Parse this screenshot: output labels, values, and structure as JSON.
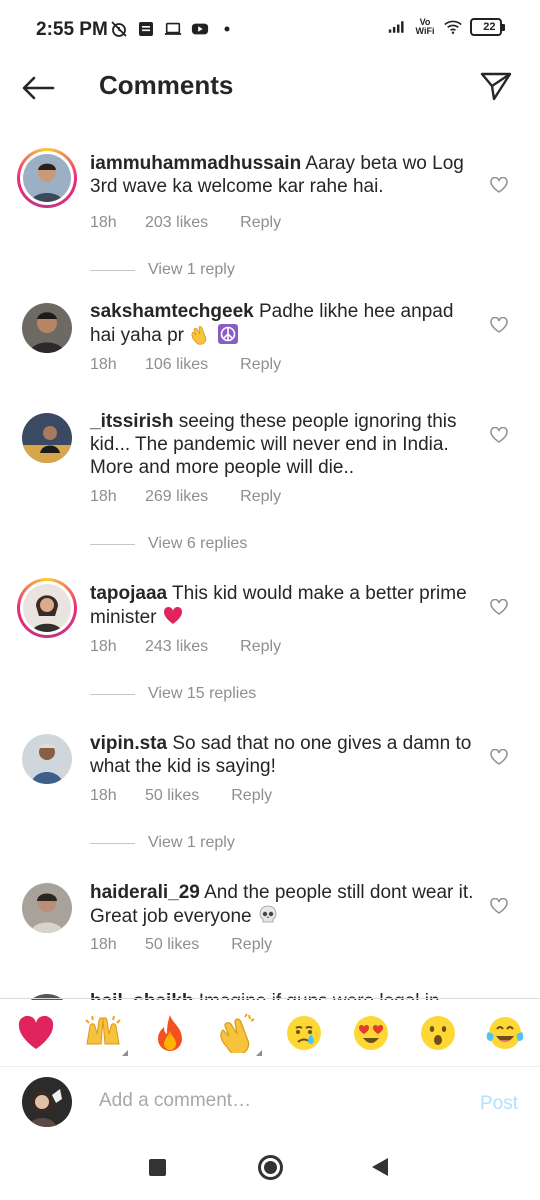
{
  "status_bar": {
    "time": "2:55 PM",
    "network_label": "Vo WiFi",
    "battery": "22"
  },
  "header": {
    "title": "Comments"
  },
  "comments": [
    {
      "username": "iammuhammadhussain",
      "text": "Aaray beta wo Log 3rd wave ka welcome kar rahe hai.",
      "time": "18h",
      "likes": "203 likes",
      "reply": "Reply",
      "view_replies": "View 1 reply",
      "has_story_ring": true
    },
    {
      "username": "sakshamtechgeek",
      "text": "Padhe likhe hee anpad hai yaha pr",
      "emojis": [
        "clapping-hands",
        "peace-symbol"
      ],
      "time": "18h",
      "likes": "106 likes",
      "reply": "Reply"
    },
    {
      "username": "_itssirish",
      "text": "seeing these people ignoring this kid... The pandemic will never end in India. More and more people will die..",
      "time": "18h",
      "likes": "269 likes",
      "reply": "Reply",
      "view_replies": "View 6 replies"
    },
    {
      "username": "tapojaaa",
      "text": "This kid would make a better prime minister",
      "emojis": [
        "red-heart"
      ],
      "time": "18h",
      "likes": "243 likes",
      "reply": "Reply",
      "view_replies": "View 15 replies",
      "has_story_ring": true
    },
    {
      "username": "vipin.sta",
      "text": "So sad that no one gives a damn to what the kid is saying!",
      "time": "18h",
      "likes": "50 likes",
      "reply": "Reply",
      "view_replies": "View 1 reply"
    },
    {
      "username": "haiderali_29",
      "text": "And the people still dont wear it. Great job everyone",
      "emojis": [
        "skull"
      ],
      "time": "18h",
      "likes": "50 likes",
      "reply": "Reply"
    },
    {
      "username": "hajl_shaikh",
      "text": "Imagine if guns were legal in",
      "partial": true
    }
  ],
  "emoji_bar": [
    {
      "name": "red-heart"
    },
    {
      "name": "raising-hands",
      "has_variants": true
    },
    {
      "name": "fire"
    },
    {
      "name": "clapping-hands",
      "has_variants": true
    },
    {
      "name": "crying-face"
    },
    {
      "name": "heart-eyes-face"
    },
    {
      "name": "surprised-face"
    },
    {
      "name": "tears-of-joy-face"
    }
  ],
  "composer": {
    "placeholder": "Add a comment…",
    "post_label": "Post"
  },
  "colors": {
    "text_primary": "#262626",
    "text_secondary": "#8e8e8e",
    "post_disabled": "#b2dffc",
    "story_ring": "#ee2a7b"
  }
}
